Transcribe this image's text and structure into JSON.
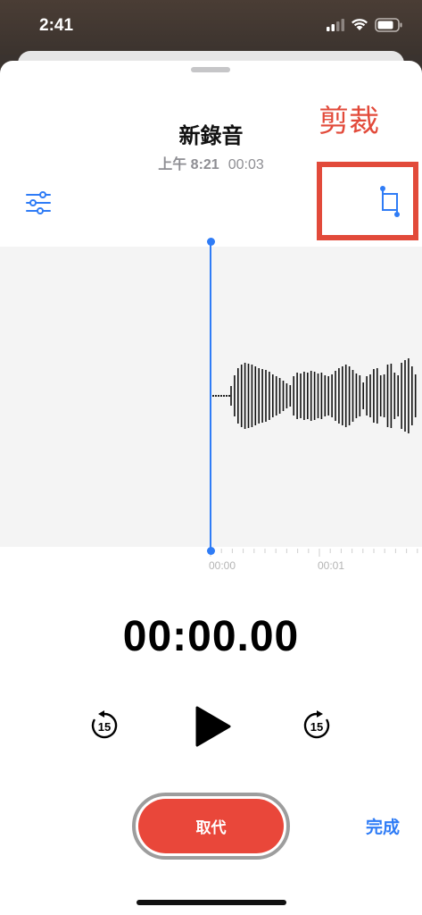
{
  "status_bar": {
    "time": "2:41"
  },
  "recording": {
    "title": "新錄音",
    "date": "上午 8:21",
    "duration": "00:03",
    "annotation_label": "剪裁"
  },
  "timeline": {
    "labels": [
      "00:00",
      "00:01"
    ]
  },
  "player": {
    "elapsed": "00:00.00",
    "skip_back_seconds": "15",
    "skip_forward_seconds": "15"
  },
  "actions": {
    "replace_label": "取代",
    "done_label": "完成"
  },
  "colors": {
    "accent": "#2f7cf6",
    "record_red": "#e9473a",
    "annotation_red": "#e24a3a"
  },
  "icons": [
    "settings-sliders-icon",
    "trim-crop-icon",
    "skip-back-15-icon",
    "play-icon",
    "skip-forward-15-icon"
  ]
}
